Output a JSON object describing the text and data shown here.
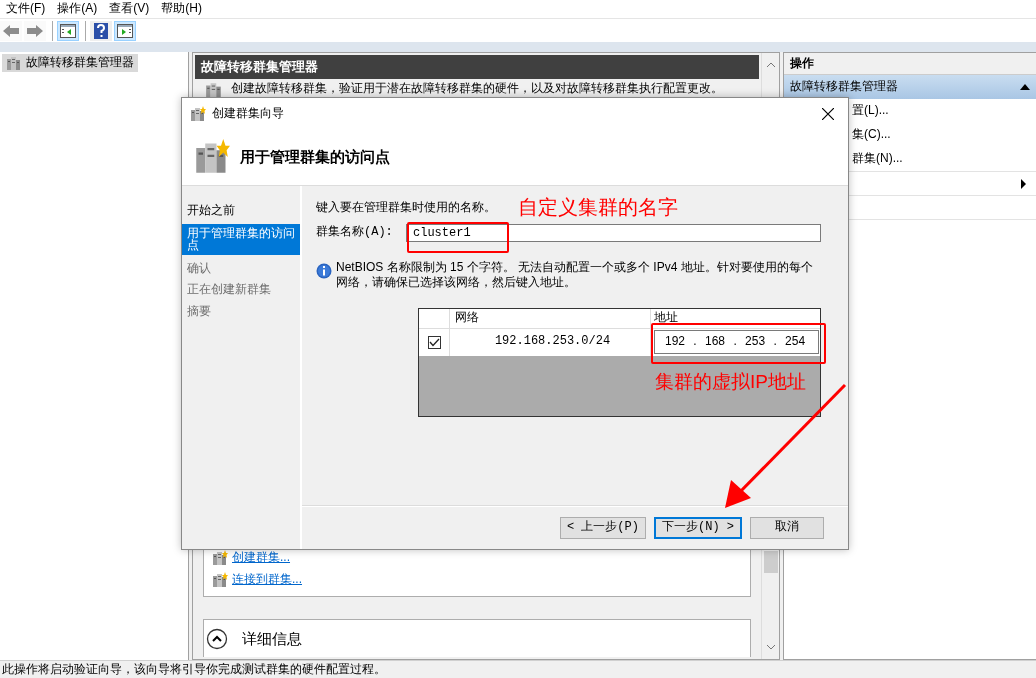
{
  "menu": [
    "文件(F)",
    "操作(A)",
    "查看(V)",
    "帮助(H)"
  ],
  "toolbar": [
    {
      "kind": "back",
      "disabled": true
    },
    {
      "kind": "forward",
      "disabled": true
    },
    {
      "kind": "separator"
    },
    {
      "kind": "tree",
      "on": true
    },
    {
      "kind": "separator"
    },
    {
      "kind": "help",
      "on": false
    },
    {
      "kind": "actions",
      "on": true
    }
  ],
  "tree": {
    "items": [
      {
        "label": "故障转移群集管理器",
        "selected": true
      }
    ]
  },
  "center": {
    "title": "故障转移群集管理器",
    "description": "创建故障转移群集，验证用于潜在故障转移群集的硬件，以及对故障转移群集执行配置更改。",
    "links": [
      "创建群集...",
      "连接到群集..."
    ],
    "details_label": "详细信息"
  },
  "actions": {
    "title": "操作",
    "group": {
      "label": "故障转移群集管理器",
      "expanded": true
    },
    "items": [
      {
        "kind": "link",
        "label": "置(L)..."
      },
      {
        "kind": "link",
        "label": "集(C)..."
      },
      {
        "kind": "link",
        "label": "群集(N)..."
      },
      {
        "kind": "row",
        "submenu": true
      },
      {
        "kind": "row",
        "submenu": false
      },
      {
        "kind": "row",
        "submenu": false
      }
    ]
  },
  "status_bar": "此操作将启动验证向导，该向导将引导你完成测试群集的硬件配置过程。",
  "dialog": {
    "title": "创建群集向导",
    "heading": "用于管理群集的访问点",
    "steps": [
      {
        "label": "开始之前",
        "selected": false,
        "disabled": false
      },
      {
        "label": "用于管理群集的访问点",
        "selected": true,
        "disabled": false
      },
      {
        "label": "确认",
        "selected": false,
        "disabled": true
      },
      {
        "label": "正在创建新群集",
        "selected": false,
        "disabled": true
      },
      {
        "label": "摘要",
        "selected": false,
        "disabled": true
      }
    ],
    "prompt": "键入要在管理群集时使用的名称。",
    "name_label": "群集名称(A):",
    "name_value": "cluster1",
    "info": "NetBIOS 名称限制为 15 个字符。 无法自动配置一个或多个 IPv4 地址。针对要使用的每个网络，请确保已选择该网络，然后键入地址。",
    "networks": {
      "columns": [
        "网络",
        "地址"
      ],
      "rows": [
        {
          "checked": true,
          "network": "192.168.253.0/24",
          "address": "192 . 168 . 253 . 254"
        }
      ]
    },
    "buttons": [
      {
        "label": "< 上一步(P)",
        "default": false
      },
      {
        "label": "下一步(N) >",
        "default": true
      },
      {
        "label": "取消",
        "default": false
      }
    ]
  },
  "annotations": [
    {
      "kind": "note",
      "text": "自定义集群的名字"
    },
    {
      "kind": "box"
    },
    {
      "kind": "box"
    },
    {
      "kind": "note",
      "text": "集群的虚拟IP地址"
    },
    {
      "kind": "arrow"
    }
  ]
}
